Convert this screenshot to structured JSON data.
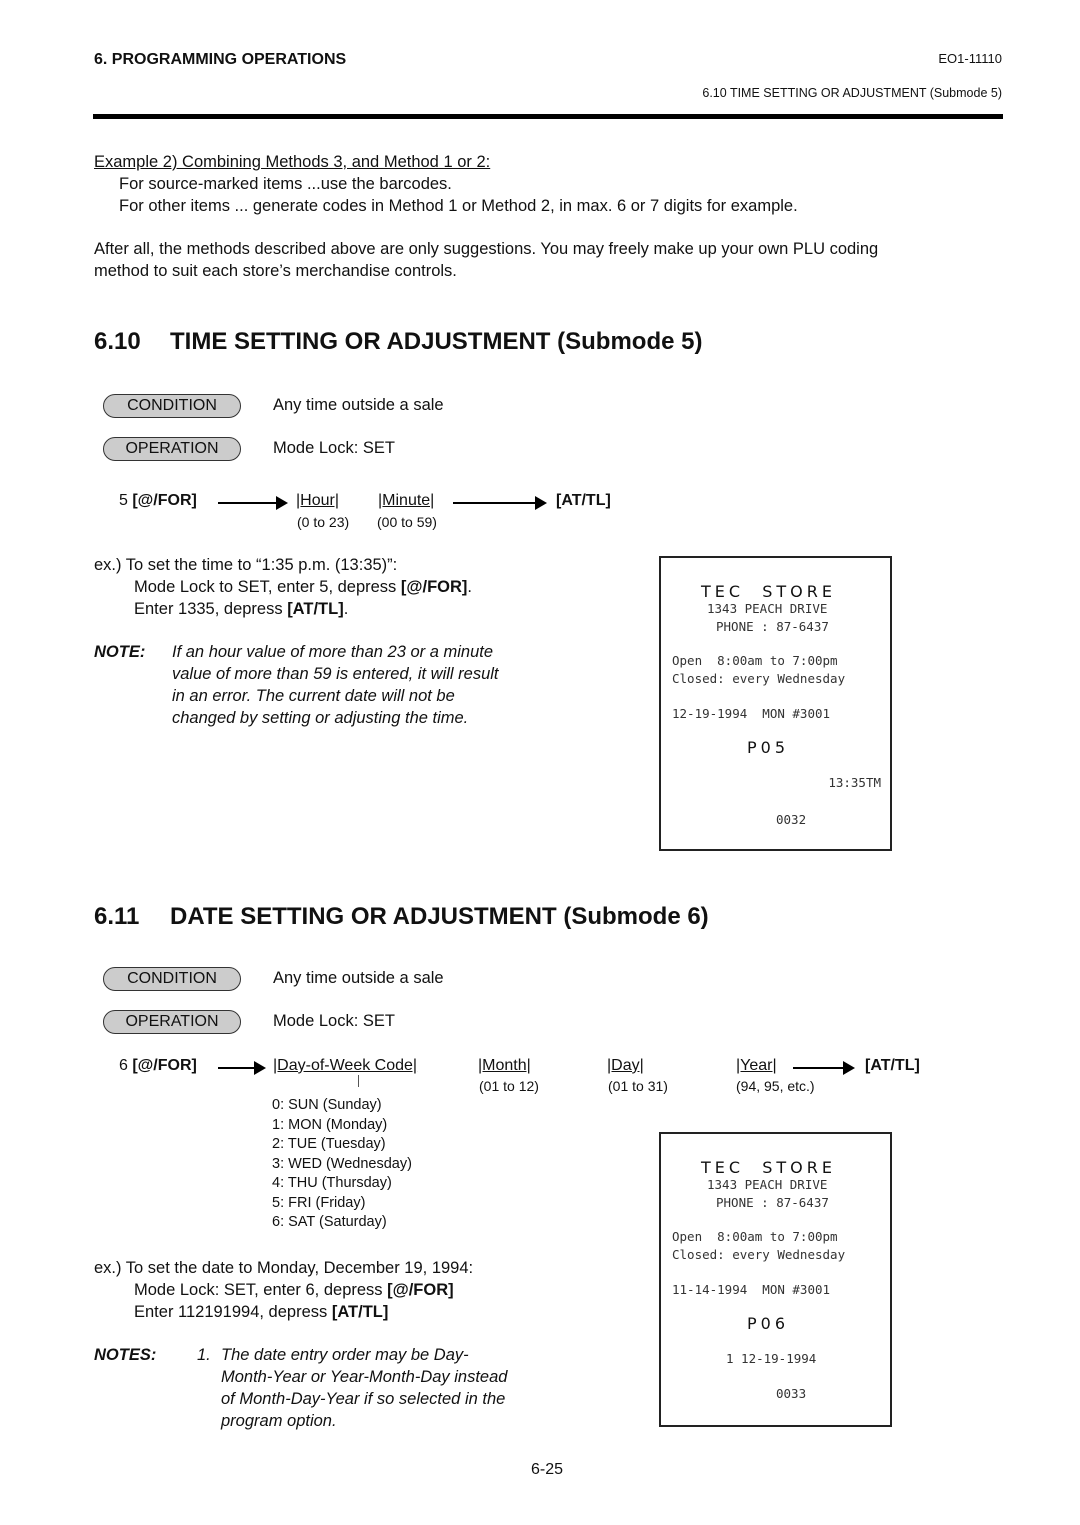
{
  "header": {
    "chapter": "6.  PROGRAMMING OPERATIONS",
    "doc_id": "EO1-11110",
    "section_ref": "6.10  TIME SETTING OR ADJUSTMENT (Submode 5)"
  },
  "intro": {
    "example_title": "Example 2)  Combining Methods 3, and Method 1 or 2:",
    "line1": "For source-marked items ...use the barcodes.",
    "line2": "For other items ... generate codes in Method 1 or Method 2, in max. 6 or 7 digits for example.",
    "para1": "After all, the methods described above are only suggestions. You may freely make up your own PLU coding",
    "para2": "method to suit each store’s merchandise controls."
  },
  "sec610": {
    "num": "6.10",
    "title": "TIME SETTING OR ADJUSTMENT (Submode 5)",
    "condition_label": "CONDITION",
    "condition_text": "Any time outside a sale",
    "operation_label": "OPERATION",
    "operation_text": "Mode Lock:  SET",
    "seq_prefix": "5 ",
    "seq_key1": "[@/FOR]",
    "field_hour": "|Hour|",
    "field_minute": "|Minute|",
    "range_hour": "(0 to 23)",
    "range_minute": "(00 to 59)",
    "seq_key2": "[AT/TL]",
    "ex_line1": "ex.)  To set the time to “1:35 p.m. (13:35)”:",
    "ex_line2_pre": "Mode Lock to SET, enter 5, depress ",
    "ex_line2_key": "[@/FOR]",
    "ex_line2_post": ".",
    "ex_line3_pre": "Enter 1335, depress ",
    "ex_line3_key": "[AT/TL]",
    "ex_line3_post": ".",
    "note_label": "NOTE:",
    "note_lines": [
      "If an hour value of more than 23 or a minute",
      "value of more than 59 is entered, it will result",
      "in an error. The current date will not be",
      "changed by setting or adjusting the time."
    ],
    "receipt": {
      "store": "TEC  STORE",
      "address": "1343 PEACH DRIVE",
      "phone": "PHONE : 87-6437",
      "hours": "Open  8:00am to 7:00pm",
      "closed": "Closed: every Wednesday",
      "date_line": "12-19-1994  MON #3001",
      "code": "P05",
      "value": "13:35TM",
      "counter": "0032"
    }
  },
  "sec611": {
    "num": "6.11",
    "title": "DATE SETTING OR ADJUSTMENT (Submode 6)",
    "condition_label": "CONDITION",
    "condition_text": "Any time outside a sale",
    "operation_label": "OPERATION",
    "operation_text": "Mode Lock:  SET",
    "seq_prefix": "6 ",
    "seq_key1": "[@/FOR]",
    "field_dow": "|Day-of-Week Code|",
    "field_month": "|Month|",
    "field_day": "|Day|",
    "field_year": "|Year|",
    "range_month": "(01 to 12)",
    "range_day": "(01 to 31)",
    "range_year": "(94, 95, etc.)",
    "seq_key2": "[AT/TL]",
    "dow_codes": [
      "0:  SUN (Sunday)",
      "1:  MON (Monday)",
      "2:  TUE (Tuesday)",
      "3:  WED (Wednesday)",
      "4:  THU (Thursday)",
      "5:  FRI (Friday)",
      "6:  SAT (Saturday)"
    ],
    "ex_line1": "ex.)  To set the date to Monday, December 19, 1994:",
    "ex_line2_pre": "Mode Lock:  SET, enter 6, depress ",
    "ex_line2_key": "[@/FOR]",
    "ex_line3_pre": "Enter 112191994, depress ",
    "ex_line3_key": "[AT/TL]",
    "notes_label": "NOTES:",
    "notes_num": "1.",
    "notes_lines": [
      "The date entry order may be Day-",
      "Month-Year or Year-Month-Day instead",
      "of Month-Day-Year if so selected in the",
      "program option."
    ],
    "receipt": {
      "store": "TEC  STORE",
      "address": "1343 PEACH DRIVE",
      "phone": "PHONE : 87-6437",
      "hours": "Open  8:00am to 7:00pm",
      "closed": "Closed: every Wednesday",
      "date_line": "11-14-1994  MON #3001",
      "code": "P06",
      "value": "1 12-19-1994",
      "counter": "0033"
    }
  },
  "footer": {
    "page_number": "6-25"
  }
}
